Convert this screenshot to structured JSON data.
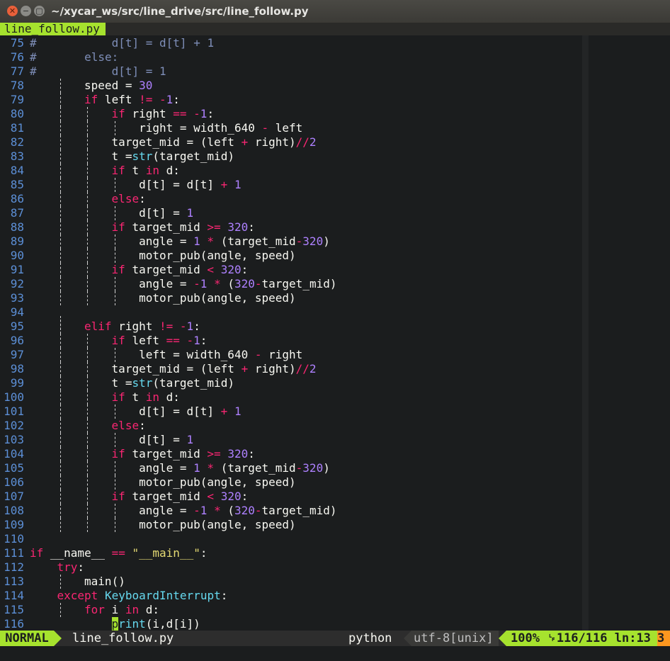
{
  "window": {
    "title": "~/xycar_ws/src/line_drive/src/line_follow.py",
    "close_glyph": "✕",
    "minimize_glyph": "−",
    "maximize_glyph": "▢"
  },
  "tabline": {
    "active_tab": "line_follow.py"
  },
  "colors": {
    "accent": "#a6e22e",
    "keyword": "#f92672",
    "number": "#ae81ff",
    "string": "#e6db74",
    "builtin": "#66d9ef",
    "comment": "#7e8eb8",
    "line_number": "#5c8fd6",
    "background": "#1b1d1e",
    "warning": "#fd971f"
  },
  "lines": [
    {
      "n": "75",
      "indent": 0,
      "guides": [],
      "tokens": [
        {
          "c": "c",
          "t": "#           d[t] = d[t] + 1"
        }
      ]
    },
    {
      "n": "76",
      "indent": 0,
      "guides": [],
      "tokens": [
        {
          "c": "c",
          "t": "#       else:"
        }
      ]
    },
    {
      "n": "77",
      "indent": 0,
      "guides": [],
      "tokens": [
        {
          "c": "c",
          "t": "#           d[t] = 1"
        }
      ]
    },
    {
      "n": "78",
      "indent": 8,
      "guides": [
        4
      ],
      "tokens": [
        {
          "t": "speed = "
        },
        {
          "c": "n",
          "t": "30"
        }
      ]
    },
    {
      "n": "79",
      "indent": 8,
      "guides": [
        4
      ],
      "tokens": [
        {
          "c": "k",
          "t": "if"
        },
        {
          "t": " left "
        },
        {
          "c": "k",
          "t": "!="
        },
        {
          "t": " "
        },
        {
          "c": "k",
          "t": "-"
        },
        {
          "c": "n",
          "t": "1"
        },
        {
          "t": ":"
        }
      ]
    },
    {
      "n": "80",
      "indent": 12,
      "guides": [
        4,
        8
      ],
      "tokens": [
        {
          "c": "k",
          "t": "if"
        },
        {
          "t": " right "
        },
        {
          "c": "k",
          "t": "=="
        },
        {
          "t": " "
        },
        {
          "c": "k",
          "t": "-"
        },
        {
          "c": "n",
          "t": "1"
        },
        {
          "t": ":"
        }
      ]
    },
    {
      "n": "81",
      "indent": 16,
      "guides": [
        4,
        8,
        12
      ],
      "tokens": [
        {
          "t": "right = width_640 "
        },
        {
          "c": "k",
          "t": "-"
        },
        {
          "t": " left"
        }
      ]
    },
    {
      "n": "82",
      "indent": 12,
      "guides": [
        4,
        8
      ],
      "tokens": [
        {
          "t": "target_mid = (left "
        },
        {
          "c": "k",
          "t": "+"
        },
        {
          "t": " right)"
        },
        {
          "c": "k",
          "t": "//"
        },
        {
          "c": "n",
          "t": "2"
        }
      ]
    },
    {
      "n": "83",
      "indent": 12,
      "guides": [
        4,
        8
      ],
      "tokens": [
        {
          "t": "t ="
        },
        {
          "c": "b",
          "t": "str"
        },
        {
          "t": "(target_mid)"
        }
      ]
    },
    {
      "n": "84",
      "indent": 12,
      "guides": [
        4,
        8
      ],
      "tokens": [
        {
          "c": "k",
          "t": "if"
        },
        {
          "t": " t "
        },
        {
          "c": "k",
          "t": "in"
        },
        {
          "t": " d:"
        }
      ]
    },
    {
      "n": "85",
      "indent": 16,
      "guides": [
        4,
        8,
        12
      ],
      "tokens": [
        {
          "t": "d[t] = d[t] "
        },
        {
          "c": "k",
          "t": "+"
        },
        {
          "t": " "
        },
        {
          "c": "n",
          "t": "1"
        }
      ]
    },
    {
      "n": "86",
      "indent": 12,
      "guides": [
        4,
        8
      ],
      "tokens": [
        {
          "c": "k",
          "t": "else"
        },
        {
          "t": ":"
        }
      ]
    },
    {
      "n": "87",
      "indent": 16,
      "guides": [
        4,
        8,
        12
      ],
      "tokens": [
        {
          "t": "d[t] = "
        },
        {
          "c": "n",
          "t": "1"
        }
      ]
    },
    {
      "n": "88",
      "indent": 12,
      "guides": [
        4,
        8
      ],
      "tokens": [
        {
          "c": "k",
          "t": "if"
        },
        {
          "t": " target_mid "
        },
        {
          "c": "k",
          "t": ">="
        },
        {
          "t": " "
        },
        {
          "c": "n",
          "t": "320"
        },
        {
          "t": ":"
        }
      ]
    },
    {
      "n": "89",
      "indent": 16,
      "guides": [
        4,
        8,
        12
      ],
      "tokens": [
        {
          "t": "angle = "
        },
        {
          "c": "n",
          "t": "1"
        },
        {
          "t": " "
        },
        {
          "c": "k",
          "t": "*"
        },
        {
          "t": " (target_mid"
        },
        {
          "c": "k",
          "t": "-"
        },
        {
          "c": "n",
          "t": "320"
        },
        {
          "t": ")"
        }
      ]
    },
    {
      "n": "90",
      "indent": 16,
      "guides": [
        4,
        8,
        12
      ],
      "tokens": [
        {
          "t": "motor_pub(angle, speed)"
        }
      ]
    },
    {
      "n": "91",
      "indent": 12,
      "guides": [
        4,
        8
      ],
      "tokens": [
        {
          "c": "k",
          "t": "if"
        },
        {
          "t": " target_mid "
        },
        {
          "c": "k",
          "t": "<"
        },
        {
          "t": " "
        },
        {
          "c": "n",
          "t": "320"
        },
        {
          "t": ":"
        }
      ]
    },
    {
      "n": "92",
      "indent": 16,
      "guides": [
        4,
        8,
        12
      ],
      "tokens": [
        {
          "t": "angle = "
        },
        {
          "c": "k",
          "t": "-"
        },
        {
          "c": "n",
          "t": "1"
        },
        {
          "t": " "
        },
        {
          "c": "k",
          "t": "*"
        },
        {
          "t": " ("
        },
        {
          "c": "n",
          "t": "320"
        },
        {
          "c": "k",
          "t": "-"
        },
        {
          "t": "target_mid)"
        }
      ]
    },
    {
      "n": "93",
      "indent": 16,
      "guides": [
        4,
        8,
        12
      ],
      "tokens": [
        {
          "t": "motor_pub(angle, speed)"
        }
      ]
    },
    {
      "n": "94",
      "indent": 0,
      "guides": [
        4
      ],
      "tokens": []
    },
    {
      "n": "95",
      "indent": 8,
      "guides": [
        4
      ],
      "tokens": [
        {
          "c": "k",
          "t": "elif"
        },
        {
          "t": " right "
        },
        {
          "c": "k",
          "t": "!="
        },
        {
          "t": " "
        },
        {
          "c": "k",
          "t": "-"
        },
        {
          "c": "n",
          "t": "1"
        },
        {
          "t": ":"
        }
      ]
    },
    {
      "n": "96",
      "indent": 12,
      "guides": [
        4,
        8
      ],
      "tokens": [
        {
          "c": "k",
          "t": "if"
        },
        {
          "t": " left "
        },
        {
          "c": "k",
          "t": "=="
        },
        {
          "t": " "
        },
        {
          "c": "k",
          "t": "-"
        },
        {
          "c": "n",
          "t": "1"
        },
        {
          "t": ":"
        }
      ]
    },
    {
      "n": "97",
      "indent": 16,
      "guides": [
        4,
        8,
        12
      ],
      "tokens": [
        {
          "t": "left = width_640 "
        },
        {
          "c": "k",
          "t": "-"
        },
        {
          "t": " right"
        }
      ]
    },
    {
      "n": "98",
      "indent": 12,
      "guides": [
        4,
        8
      ],
      "tokens": [
        {
          "t": "target_mid = (left "
        },
        {
          "c": "k",
          "t": "+"
        },
        {
          "t": " right)"
        },
        {
          "c": "k",
          "t": "//"
        },
        {
          "c": "n",
          "t": "2"
        }
      ]
    },
    {
      "n": "99",
      "indent": 12,
      "guides": [
        4,
        8
      ],
      "tokens": [
        {
          "t": "t ="
        },
        {
          "c": "b",
          "t": "str"
        },
        {
          "t": "(target_mid)"
        }
      ]
    },
    {
      "n": "100",
      "indent": 12,
      "guides": [
        4,
        8
      ],
      "tokens": [
        {
          "c": "k",
          "t": "if"
        },
        {
          "t": " t "
        },
        {
          "c": "k",
          "t": "in"
        },
        {
          "t": " d:"
        }
      ]
    },
    {
      "n": "101",
      "indent": 16,
      "guides": [
        4,
        8,
        12
      ],
      "tokens": [
        {
          "t": "d[t] = d[t] "
        },
        {
          "c": "k",
          "t": "+"
        },
        {
          "t": " "
        },
        {
          "c": "n",
          "t": "1"
        }
      ]
    },
    {
      "n": "102",
      "indent": 12,
      "guides": [
        4,
        8
      ],
      "tokens": [
        {
          "c": "k",
          "t": "else"
        },
        {
          "t": ":"
        }
      ]
    },
    {
      "n": "103",
      "indent": 16,
      "guides": [
        4,
        8,
        12
      ],
      "tokens": [
        {
          "t": "d[t] = "
        },
        {
          "c": "n",
          "t": "1"
        }
      ]
    },
    {
      "n": "104",
      "indent": 12,
      "guides": [
        4,
        8
      ],
      "tokens": [
        {
          "c": "k",
          "t": "if"
        },
        {
          "t": " target_mid "
        },
        {
          "c": "k",
          "t": ">="
        },
        {
          "t": " "
        },
        {
          "c": "n",
          "t": "320"
        },
        {
          "t": ":"
        }
      ]
    },
    {
      "n": "105",
      "indent": 16,
      "guides": [
        4,
        8,
        12
      ],
      "tokens": [
        {
          "t": "angle = "
        },
        {
          "c": "n",
          "t": "1"
        },
        {
          "t": " "
        },
        {
          "c": "k",
          "t": "*"
        },
        {
          "t": " (target_mid"
        },
        {
          "c": "k",
          "t": "-"
        },
        {
          "c": "n",
          "t": "320"
        },
        {
          "t": ")"
        }
      ]
    },
    {
      "n": "106",
      "indent": 16,
      "guides": [
        4,
        8,
        12
      ],
      "tokens": [
        {
          "t": "motor_pub(angle, speed)"
        }
      ]
    },
    {
      "n": "107",
      "indent": 12,
      "guides": [
        4,
        8
      ],
      "tokens": [
        {
          "c": "k",
          "t": "if"
        },
        {
          "t": " target_mid "
        },
        {
          "c": "k",
          "t": "<"
        },
        {
          "t": " "
        },
        {
          "c": "n",
          "t": "320"
        },
        {
          "t": ":"
        }
      ]
    },
    {
      "n": "108",
      "indent": 16,
      "guides": [
        4,
        8,
        12
      ],
      "tokens": [
        {
          "t": "angle = "
        },
        {
          "c": "k",
          "t": "-"
        },
        {
          "c": "n",
          "t": "1"
        },
        {
          "t": " "
        },
        {
          "c": "k",
          "t": "*"
        },
        {
          "t": " ("
        },
        {
          "c": "n",
          "t": "320"
        },
        {
          "c": "k",
          "t": "-"
        },
        {
          "t": "target_mid)"
        }
      ]
    },
    {
      "n": "109",
      "indent": 16,
      "guides": [
        4,
        8,
        12
      ],
      "tokens": [
        {
          "t": "motor_pub(angle, speed)"
        }
      ]
    },
    {
      "n": "110",
      "indent": 0,
      "guides": [],
      "tokens": []
    },
    {
      "n": "111",
      "indent": 0,
      "guides": [],
      "tokens": [
        {
          "c": "k",
          "t": "if"
        },
        {
          "t": " __name__ "
        },
        {
          "c": "k",
          "t": "=="
        },
        {
          "t": " "
        },
        {
          "c": "s",
          "t": "\"__main__\""
        },
        {
          "t": ":"
        }
      ]
    },
    {
      "n": "112",
      "indent": 4,
      "guides": [],
      "tokens": [
        {
          "c": "k",
          "t": "try"
        },
        {
          "t": ":"
        }
      ]
    },
    {
      "n": "113",
      "indent": 8,
      "guides": [
        4
      ],
      "tokens": [
        {
          "t": "main()"
        }
      ]
    },
    {
      "n": "114",
      "indent": 4,
      "guides": [],
      "tokens": [
        {
          "c": "k",
          "t": "except"
        },
        {
          "t": " "
        },
        {
          "c": "b",
          "t": "KeyboardInterrupt"
        },
        {
          "t": ":"
        }
      ]
    },
    {
      "n": "115",
      "indent": 8,
      "guides": [
        4
      ],
      "tokens": [
        {
          "c": "k",
          "t": "for"
        },
        {
          "t": " i "
        },
        {
          "c": "k",
          "t": "in"
        },
        {
          "t": " d:"
        }
      ]
    },
    {
      "n": "116",
      "indent": 12,
      "guides": [],
      "tokens": [
        {
          "c": "cur",
          "t": "p"
        },
        {
          "c": "b",
          "t": "rint"
        },
        {
          "t": "(i,d[i])"
        }
      ]
    }
  ],
  "statusline": {
    "mode": "NORMAL",
    "filename": "line_follow.py",
    "filetype": "python",
    "encoding": "utf-8[unix]",
    "percent": "100%",
    "line_icon": "␊",
    "position": "116/116",
    "column_label": "ln",
    "column": ":13",
    "warning_glyph": "3"
  }
}
